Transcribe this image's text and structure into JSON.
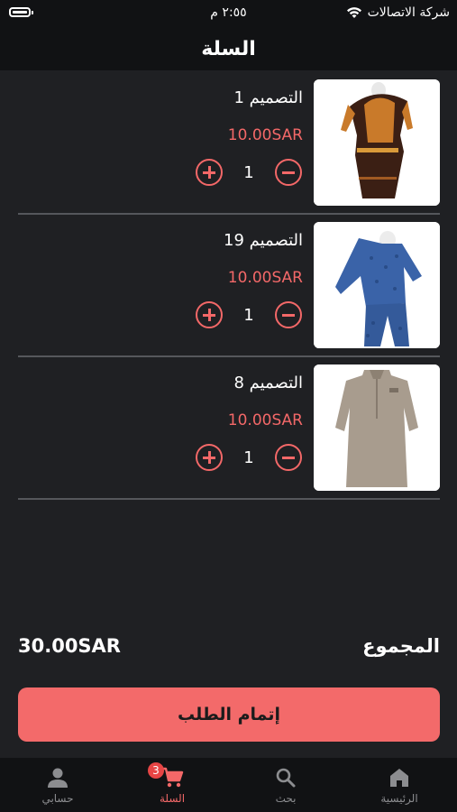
{
  "status_bar": {
    "time": "٢:٥٥ م",
    "carrier": "شركة الاتصالات"
  },
  "header": {
    "title": "السلة"
  },
  "cart_items": [
    {
      "name": "التصميم 1",
      "price": "10.00SAR",
      "quantity": "1"
    },
    {
      "name": "التصميم 19",
      "price": "10.00SAR",
      "quantity": "1"
    },
    {
      "name": "التصميم 8",
      "price": "10.00SAR",
      "quantity": "1"
    }
  ],
  "summary": {
    "total_label": "المجموع",
    "total_value": "30.00SAR"
  },
  "checkout": {
    "label": "إتمام الطلب"
  },
  "tabs": [
    {
      "label": "الرئيسية",
      "icon": "home-icon"
    },
    {
      "label": "بحث",
      "icon": "search-icon"
    },
    {
      "label": "السلة",
      "icon": "cart-icon",
      "badge": "3"
    },
    {
      "label": "حسابي",
      "icon": "user-icon"
    }
  ],
  "colors": {
    "accent": "#f36868",
    "background": "#1f2023",
    "bar": "#111214"
  }
}
